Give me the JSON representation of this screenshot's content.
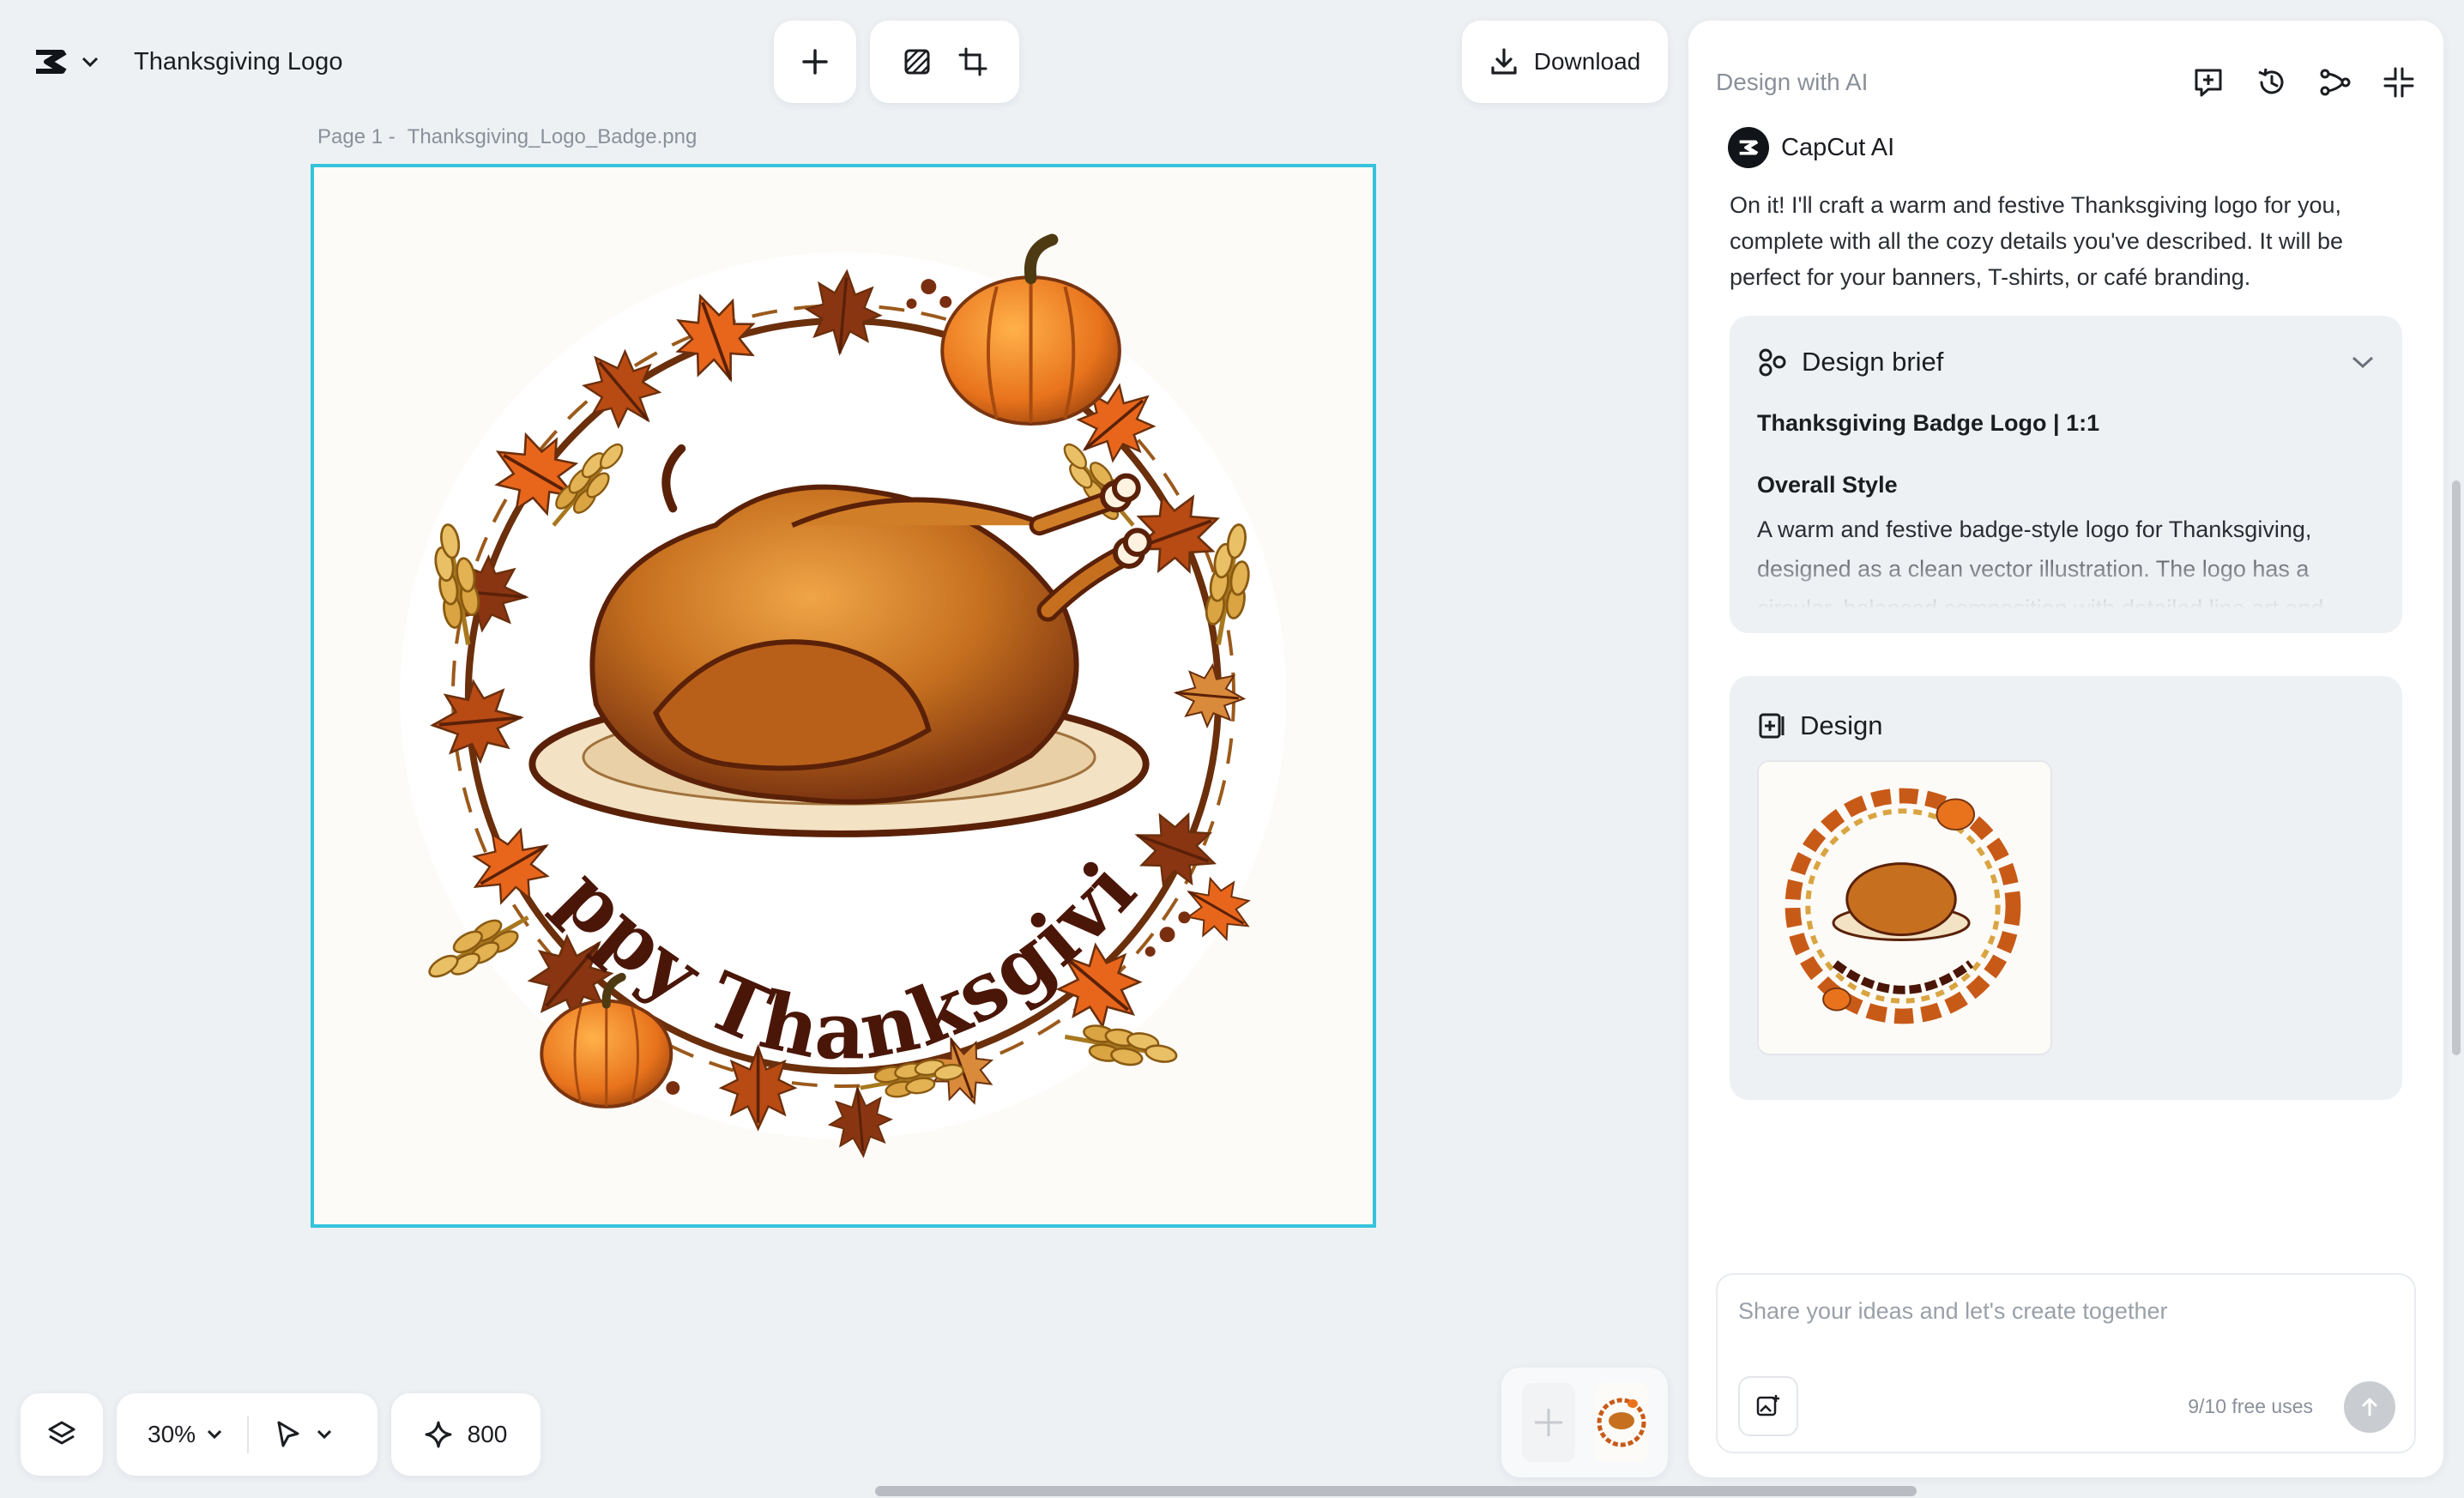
{
  "app": {
    "project_title": "Thanksgiving Logo",
    "logo_icon": "capcut-logo-icon"
  },
  "toolbar": {
    "add_icon": "plus-icon",
    "tools": [
      "remove-background-icon",
      "resize-icon"
    ],
    "download_label": "Download",
    "download_icon": "download-icon"
  },
  "canvas": {
    "page_label": "Page 1 -",
    "file_name": "Thanksgiving_Logo_Badge.png",
    "artwork_text": "Happy Thanksgiving",
    "selection_color": "#35c4dc"
  },
  "bottom_bar": {
    "layers_icon": "layers-icon",
    "zoom": "30%",
    "select_tool_icon": "pointer-icon",
    "credits": "800",
    "credits_icon": "sparkle-icon"
  },
  "panel": {
    "title": "Design with AI",
    "header_icons": [
      "new-chat-icon",
      "history-icon",
      "share-icon",
      "collapse-icon"
    ],
    "assistant_name": "CapCut AI",
    "message": "On it! I'll craft a warm and festive Thanksgiving logo for you, complete with all the cozy details you've described. It will be perfect for your banners, T-shirts, or café branding.",
    "brief": {
      "title": "Design brief",
      "subtitle": "Thanksgiving Badge Logo | 1:1",
      "section_title": "Overall Style",
      "description": "A warm and festive badge-style logo for Thanksgiving, designed as a clean vector illustration. The logo has a circular, balanced composition with detailed line art and"
    },
    "design": {
      "title": "Design"
    },
    "composer": {
      "placeholder": "Share your ideas and let's create together",
      "usage": "9/10 free uses"
    }
  },
  "colors": {
    "accent": "#35c4dc",
    "maple_dark": "#8a3512",
    "maple_orange": "#e8661c",
    "wheat": "#d9a441",
    "turkey": "#c6701f",
    "text_brown": "#4a1608"
  }
}
